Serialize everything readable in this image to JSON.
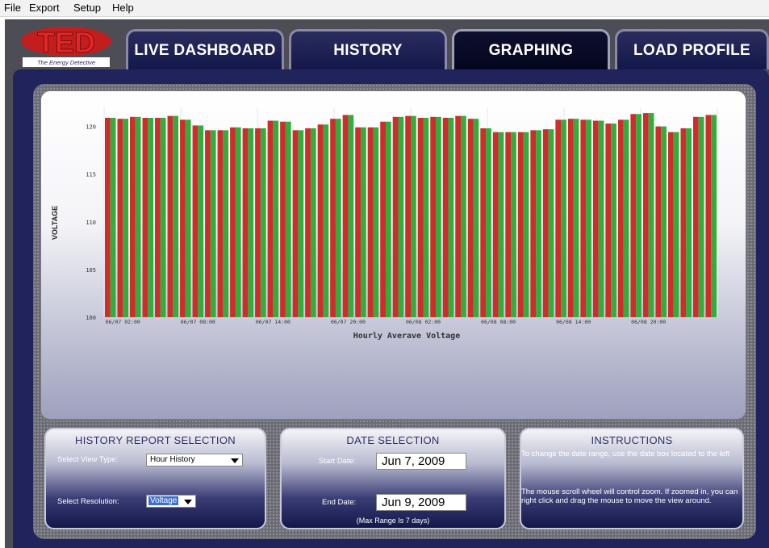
{
  "menu": {
    "file": "File",
    "export": "Export",
    "setup": "Setup",
    "help": "Help"
  },
  "logo": {
    "brand": "TED",
    "tagline": "The Energy Detective"
  },
  "tabs": [
    {
      "label": "LIVE DASHBOARD",
      "active": false
    },
    {
      "label": "HISTORY",
      "active": false
    },
    {
      "label": "GRAPHING",
      "active": true
    },
    {
      "label": "LOAD PROFILE",
      "active": false
    }
  ],
  "history_report": {
    "title": "HISTORY REPORT SELECTION",
    "view_type_label": "Select View Type:",
    "view_type_value": "Hour History",
    "resolution_label": "Select Resolution:",
    "resolution_value": "Voltage"
  },
  "date_selection": {
    "title": "DATE SELECTION",
    "start_label": "Start Date:",
    "start_value": "Jun 7, 2009",
    "end_label": "End Date:",
    "end_value": "Jun 9, 2009",
    "note": "(Max Range Is 7 days)"
  },
  "instructions": {
    "title": "INSTRUCTIONS",
    "text1": "To change the date range, use the date box located to the left",
    "text2": "The mouse scroll wheel will control zoom. If zoomed in, you can right click and drag the mouse to move the view around."
  },
  "colors": {
    "bar_red": "#d12b2b",
    "bar_green": "#2fae3c",
    "panel": "#20235c"
  },
  "chart_data": {
    "type": "bar",
    "title": "",
    "xlabel": "Hourly Averave Voltage",
    "ylabel": "VOLTAGE",
    "ylim": [
      100,
      122
    ],
    "yticks": [
      100,
      105,
      110,
      115,
      120
    ],
    "xtick_labels": [
      "06/07 02:00",
      "06/07 08:00",
      "06/07 14:00",
      "06/07 20:00",
      "06/08 02:00",
      "06/08 08:00",
      "06/08 14:00",
      "06/08 20:00"
    ],
    "values": [
      120.9,
      120.8,
      121.0,
      120.9,
      120.9,
      121.1,
      120.7,
      120.1,
      119.6,
      119.6,
      119.9,
      119.8,
      119.8,
      120.6,
      120.5,
      119.6,
      119.8,
      120.2,
      120.8,
      121.2,
      119.9,
      119.9,
      120.5,
      121.0,
      121.1,
      120.9,
      121.0,
      120.9,
      121.1,
      120.8,
      119.8,
      119.4,
      119.4,
      119.4,
      119.6,
      119.7,
      120.7,
      120.8,
      120.7,
      120.6,
      120.3,
      120.7,
      121.3,
      121.4,
      120.0,
      119.4,
      119.8,
      121.0,
      121.2
    ],
    "grid": true,
    "legend": "none"
  }
}
